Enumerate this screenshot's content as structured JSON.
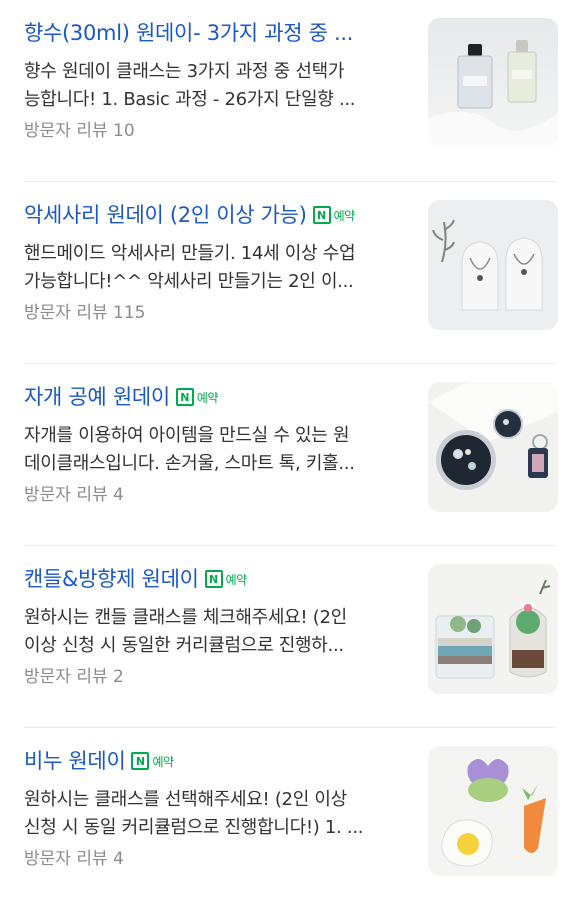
{
  "items": [
    {
      "title": "향수(30ml) 원데이- 3가지 과정 중 ...",
      "booking_label": "",
      "desc_line1": "향수 원데이 클래스는 3가지 과정 중 선택가",
      "desc_line2": "능합니다! 1. Basic 과정 - 26가지 단일향 ...",
      "reviews": "방문자 리뷰 10",
      "thumbnail_icon": "perfume-bottles-photo"
    },
    {
      "title": "악세사리 원데이 (2인 이상 가능)",
      "booking_label": "예약",
      "desc_line1": "핸드메이드 악세사리 만들기. 14세 이상 수업",
      "desc_line2": "가능합니다!^^ 악세사리 만들기는 2인 이...",
      "reviews": "방문자 리뷰 115",
      "thumbnail_icon": "necklace-display-photo"
    },
    {
      "title": "자개 공예 원데이",
      "booking_label": "예약",
      "desc_line1": "자개를 이용하여 아이템을 만드실 수 있는 원",
      "desc_line2": "데이클래스입니다. 손거울, 스마트 톡, 키홀...",
      "reviews": "방문자 리뷰 4",
      "thumbnail_icon": "mother-of-pearl-craft-photo"
    },
    {
      "title": "캔들&방향제 원데이",
      "booking_label": "예약",
      "desc_line1": "원하시는 캔들 클래스를 체크해주세요! (2인",
      "desc_line2": "이상 신청 시 동일한 커리큘럼으로 진행하...",
      "reviews": "방문자 리뷰 2",
      "thumbnail_icon": "succulent-candle-photo"
    },
    {
      "title": "비누 원데이",
      "booking_label": "예약",
      "desc_line1": "원하시는 클래스를 선택해주세요! (2인 이상",
      "desc_line2": "신청 시 동일 커리큘럼으로 진행합니다!) 1. ...",
      "reviews": "방문자 리뷰 4",
      "thumbnail_icon": "handmade-soap-photo"
    }
  ],
  "colors": {
    "title": "#1a58c7",
    "badge_green": "#03a94d",
    "desc": "#333333",
    "meta": "#8c8c8c"
  }
}
